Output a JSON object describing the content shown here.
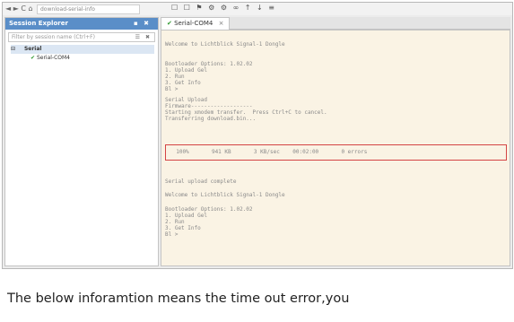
{
  "toolbar": {
    "nav": "◄ ► C ⌂",
    "address": "download-serial-info",
    "tools": "☐ ☐ ⚑ ⚙ ⚙ ∞ ↑ ↓ ≡"
  },
  "left_panel": {
    "title": "Session Explorer",
    "title_buttons": "▪ ✖",
    "filter_placeholder": "Filter by session name (Ctrl+F)",
    "filter_icons": "☰ ✖",
    "tree": {
      "group_expand": "⊟",
      "group_label": "Serial",
      "item_label": "Serial-COM4"
    }
  },
  "right_panel": {
    "tab_label": "Serial-COM4",
    "tab_close": "×",
    "terminal_lines": [
      "Welcome to Lichtblick Signal-1 Dongle",
      "",
      "Bootloader Options: 1.02.02",
      "1. Upload Gel",
      "2. Run",
      "3. Get Info",
      "Bl >",
      "Serial Upload",
      "Firmware-------------------",
      "Starting xmodem transfer.  Press Ctrl+C to cancel.",
      "Transferring download.bin...",
      "",
      "",
      "",
      "",
      "Serial upload complete",
      "",
      "Welcome to Lichtblick Signal-1 Dongle",
      "",
      "Bootloader Options: 1.02.02",
      "1. Upload Gel",
      "2. Run",
      "3. Get Info",
      "Bl >"
    ],
    "highlighted_line": "  100%       941 KB       3 KB/sec    00:02:00       0 errors"
  },
  "caption": "The below inforamtion means the time out error,you",
  "colors": {
    "accent": "#5a8ec8",
    "terminal_bg": "#faf3e4",
    "highlight_border": "#d44444",
    "connected_check": "#2f9a2f"
  }
}
